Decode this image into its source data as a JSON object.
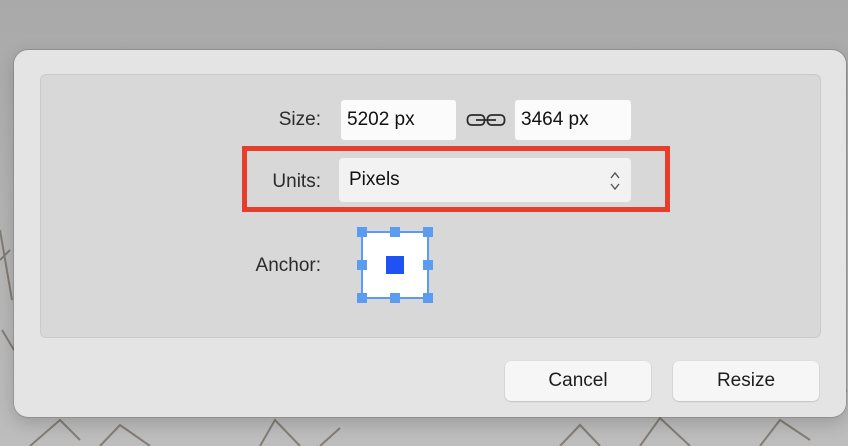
{
  "dialog": {
    "size": {
      "label": "Size:",
      "width_value": "5202 px",
      "height_value": "3464 px",
      "link_icon": "chain-link-icon"
    },
    "units": {
      "label": "Units:",
      "selected": "Pixels",
      "stepper_icon": "up-down-chevron-icon"
    },
    "anchor": {
      "label": "Anchor:",
      "selected_position": "center"
    },
    "buttons": {
      "cancel_label": "Cancel",
      "resize_label": "Resize"
    }
  },
  "colors": {
    "highlight": "#e53e2b",
    "anchor_accent": "#5b9cf0",
    "anchor_center": "#1f52f2"
  }
}
